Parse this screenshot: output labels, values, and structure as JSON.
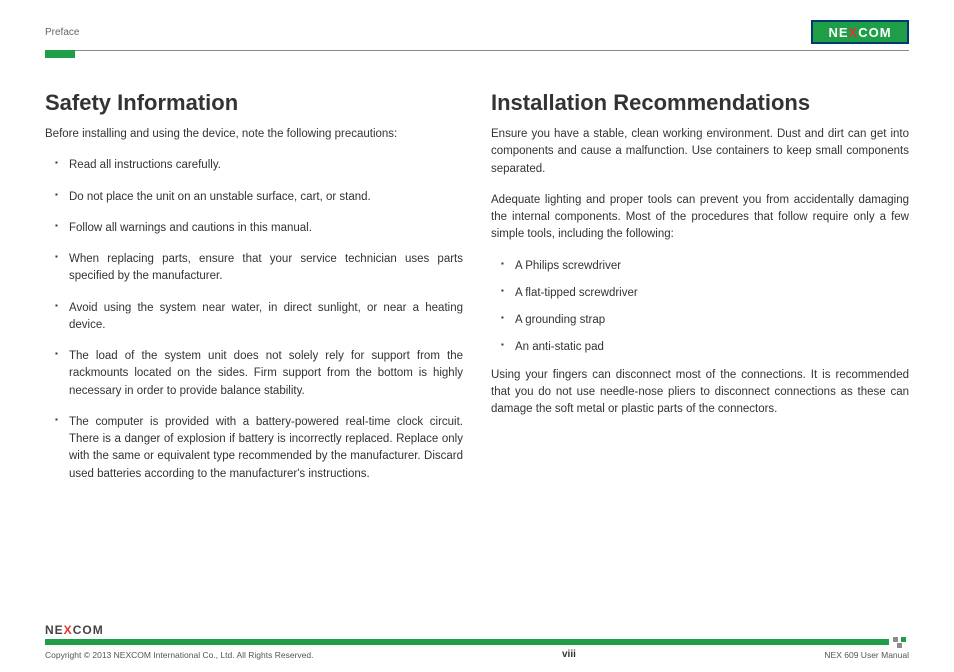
{
  "header": {
    "section_label": "Preface",
    "logo_text_left": "NE",
    "logo_text_x": "X",
    "logo_text_right": "COM"
  },
  "left": {
    "title": "Safety Information",
    "intro": "Before installing and using the device, note the following precautions:",
    "bullets": [
      "Read all instructions carefully.",
      "Do not place the unit on an unstable surface, cart, or stand.",
      "Follow all warnings and cautions in this manual.",
      "When replacing parts, ensure that your service technician uses parts specified by the manufacturer.",
      "Avoid using the system near water, in direct sunlight, or near a heating device.",
      "The load of the system unit does not solely rely for support from the rackmounts located on the sides. Firm support from the bottom is highly necessary in order to provide balance stability.",
      "The computer is provided with a battery-powered real-time clock circuit. There is a danger of explosion if battery is incorrectly replaced. Replace only with the same or equivalent type recommended by the manufacturer. Discard used batteries according to the manufacturer's instructions."
    ]
  },
  "right": {
    "title": "Installation Recommendations",
    "para1": "Ensure you have a stable, clean working environment. Dust and dirt can get into components and cause a malfunction. Use containers to keep small components separated.",
    "para2": "Adequate lighting and proper tools can prevent you from accidentally damaging the internal components. Most of the procedures that follow require only a few simple tools, including the following:",
    "bullets": [
      "A Philips screwdriver",
      "A flat-tipped screwdriver",
      "A grounding strap",
      "An anti-static pad"
    ],
    "para3": "Using your fingers can disconnect most of the connections. It is recommended that you do not use needle-nose pliers to disconnect connections as these can damage the soft metal or plastic parts of the connectors."
  },
  "footer": {
    "logo_left": "NE",
    "logo_x": "X",
    "logo_right": "COM",
    "copyright": "Copyright © 2013 NEXCOM International Co., Ltd. All Rights Reserved.",
    "page_number": "viii",
    "manual_ref": "NEX 609 User Manual"
  }
}
